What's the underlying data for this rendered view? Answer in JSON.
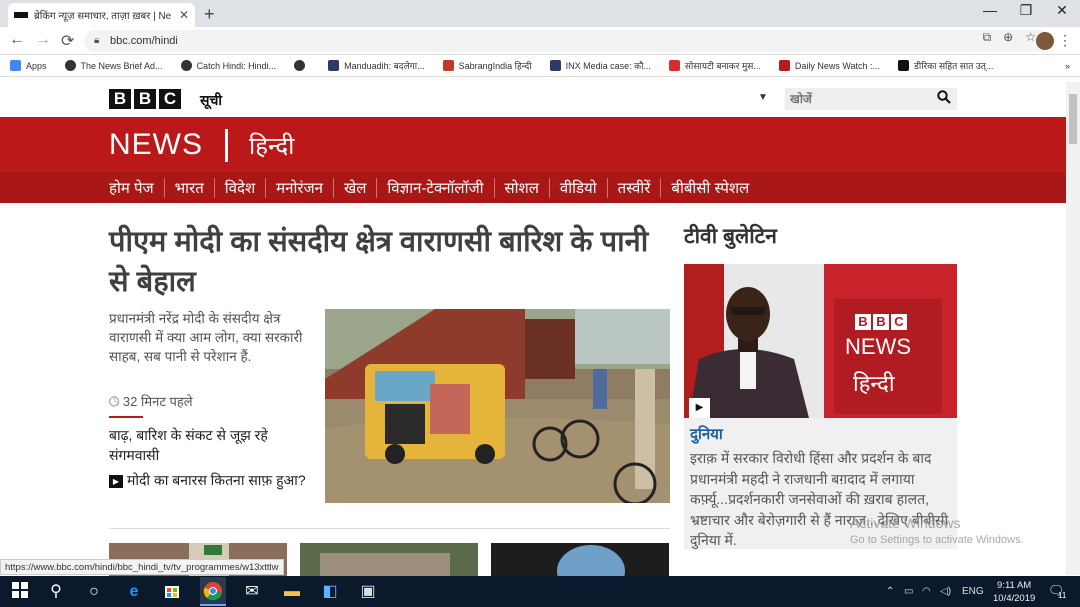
{
  "browser": {
    "tab_title": "ब्रेकिंग न्यूज़ समाचार, ताज़ा ख़बर | Ne",
    "tab_close": "✕",
    "new_tab": "+",
    "window_controls": {
      "minimize": "—",
      "restore": "❐",
      "close": "✕"
    },
    "url": "bbc.com/hindi",
    "bookmarks": [
      {
        "label": "Apps",
        "icon": "apps-icon",
        "color": "#4285f4"
      },
      {
        "label": "The News Brief Ad...",
        "icon": "globe-icon",
        "color": "#333333"
      },
      {
        "label": "Catch Hindi: Hindi...",
        "icon": "globe-icon",
        "color": "#333333"
      },
      {
        "label": "",
        "icon": "globe-icon",
        "color": "#333333"
      },
      {
        "label": "Manduadih: बदलेगा...",
        "icon": "site-icon",
        "color": "#2b3a67"
      },
      {
        "label": "SabrangIndia हिन्दी",
        "icon": "site-icon",
        "color": "#c0392b"
      },
      {
        "label": "INX Media case: कौ...",
        "icon": "site-icon",
        "color": "#2b3a67"
      },
      {
        "label": "सोसायटी बनाकर मुस...",
        "icon": "site-icon",
        "color": "#d32f2f"
      },
      {
        "label": "Daily News Watch :...",
        "icon": "site-icon",
        "color": "#b71c1c"
      },
      {
        "label": "डीरिका सहित सात उत्...",
        "icon": "site-icon",
        "color": "#111111"
      }
    ],
    "more_bookmarks": "»"
  },
  "bbc": {
    "logo_letters": [
      "B",
      "B",
      "C"
    ],
    "menu_label": "सूची",
    "search_placeholder": "खोजें",
    "news_word": "NEWS",
    "hindi_word": "हिन्दी",
    "nav": [
      "होम पेज",
      "भारत",
      "विदेश",
      "मनोरंजन",
      "खेल",
      "विज्ञान-टेक्नॉलॉजी",
      "सोशल",
      "वीडियो",
      "तस्वीरें",
      "बीबीसी स्पेशल"
    ],
    "brand_red": "#bb1919"
  },
  "main_story": {
    "headline": "पीएम मोदी का संसदीय क्षेत्र वाराणसी बारिश के पानी से बेहाल",
    "summary": "प्रधानमंत्री नरेंद्र मोदी के संसदीय क्षेत्र वाराणसी में क्या आम लोग, क्या सरकारी साहब, सब पानी से परेशान हैं.",
    "time_ago": "32 मिनट पहले",
    "related_1": "बाढ़, बारिश के संकट से जूझ रहे संगमवासी",
    "related_2": "मोदी का बनारस कितना साफ़ हुआ?"
  },
  "tv_bulletin": {
    "title": "टीवी बुलेटिन",
    "card_logo": [
      "B",
      "B",
      "C"
    ],
    "card_news": "NEWS",
    "card_hindi": "हिन्दी",
    "category": "दुनिया",
    "text": "इराक़ में सरकार विरोधी हिंसा और प्रदर्शन के बाद प्रधानमंत्री महदी ने राजधानी बग़दाद में लगाया कर्फ़्यू...प्रदर्शनकारी जनसेवाओं की ख़राब हालत, भ्रष्टाचार और बेरोज़गारी से हैं नाराज़...देखिए बीबीसी दुनिया में."
  },
  "watermark": {
    "line1": "Activate Windows",
    "line2": "Go to Settings to activate Windows."
  },
  "status_url": "https://www.bbc.com/hindi/bbc_hindi_tv/tv_programmes/w13xttlw",
  "taskbar": {
    "language": "ENG",
    "time": "9:11 AM",
    "date": "10/4/2019",
    "notification_count": "11"
  }
}
